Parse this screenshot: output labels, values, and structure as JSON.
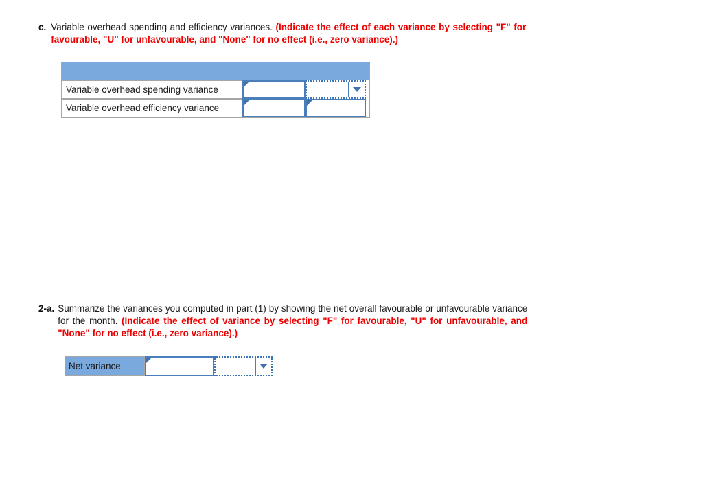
{
  "questions": [
    {
      "label": "c.",
      "text": "Variable overhead spending and efficiency variances. ",
      "hint": "(Indicate the effect of each variance by selecting \"F\" for favourable, \"U\" for unfavourable, and \"None\" for no effect (i.e., zero variance).)"
    },
    {
      "label": "2-a.",
      "text": "Summarize the variances you computed in part (1) by showing the net overall favourable or unfavourable variance for the month. ",
      "hint": "(Indicate the effect of variance by selecting \"F\" for favourable, \"U\" for unfavourable, and \"None\" for no effect (i.e., zero variance).)"
    }
  ],
  "tables": {
    "variance_table": {
      "header_label": "",
      "rows": [
        {
          "label": "Variable overhead spending variance",
          "amount": "",
          "effect": ""
        },
        {
          "label": "Variable overhead efficiency variance",
          "amount": "",
          "effect": ""
        }
      ]
    },
    "net_variance_table": {
      "rows": [
        {
          "label": "Net variance",
          "amount": "",
          "effect": ""
        }
      ]
    }
  },
  "icons": {
    "dropdown": "chevron-down-icon"
  },
  "colors": {
    "header_blue": "#7aa9dd",
    "border_blue": "#4a7ebb",
    "hint_red": "#ee0000",
    "table_border_gray": "#a6a6a6"
  }
}
